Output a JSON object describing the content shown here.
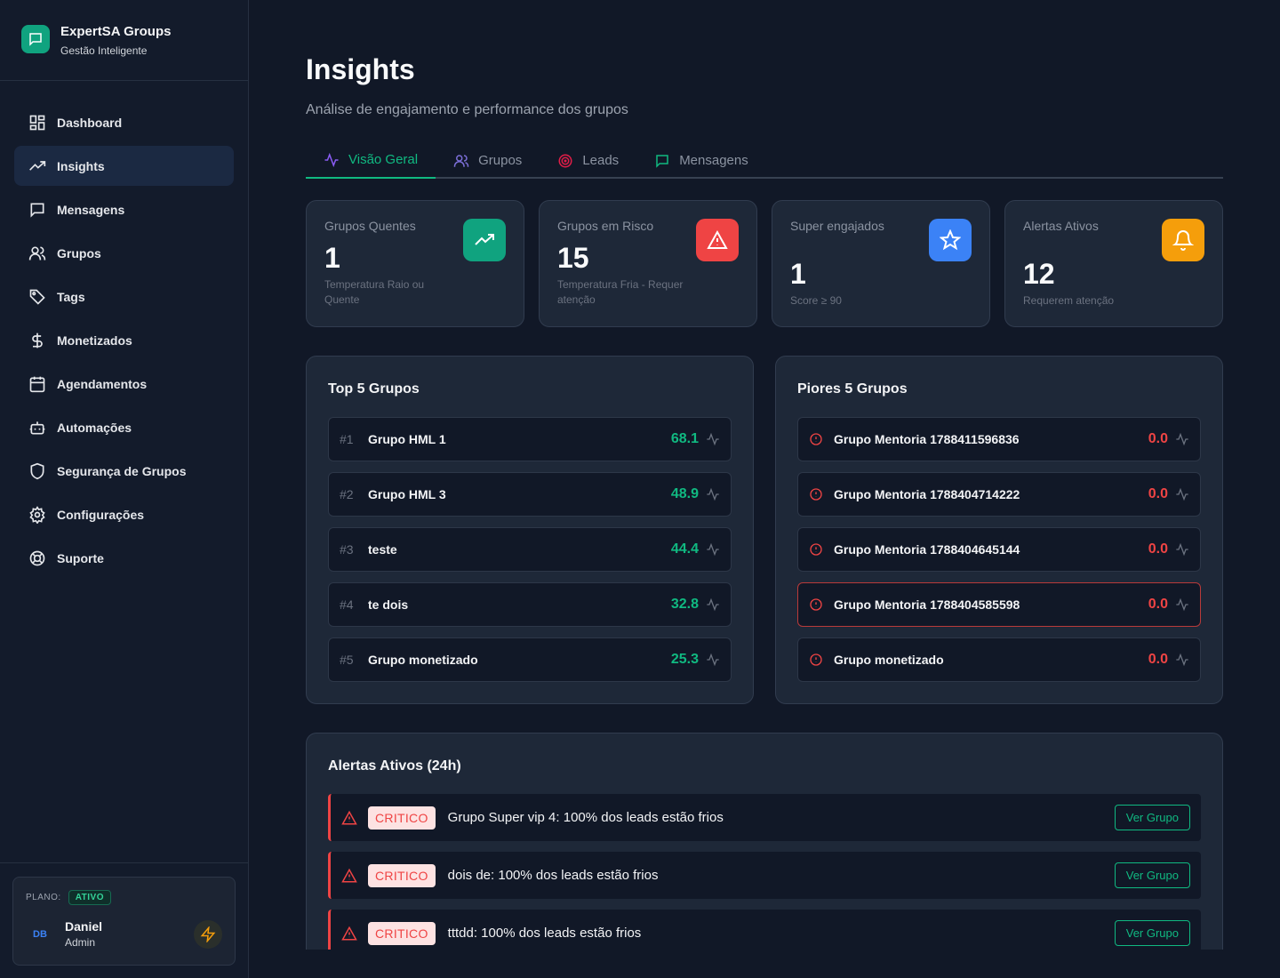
{
  "brand": {
    "title": "ExpertSA Groups",
    "subtitle": "Gestão Inteligente"
  },
  "nav": [
    {
      "label": "Dashboard",
      "icon": "grid-icon"
    },
    {
      "label": "Insights",
      "icon": "trending-up-icon",
      "active": true
    },
    {
      "label": "Mensagens",
      "icon": "message-icon"
    },
    {
      "label": "Grupos",
      "icon": "users-icon"
    },
    {
      "label": "Tags",
      "icon": "tag-icon"
    },
    {
      "label": "Monetizados",
      "icon": "dollar-icon"
    },
    {
      "label": "Agendamentos",
      "icon": "calendar-icon"
    },
    {
      "label": "Automações",
      "icon": "robot-icon"
    },
    {
      "label": "Segurança de Grupos",
      "icon": "shield-icon"
    },
    {
      "label": "Configurações",
      "icon": "gear-icon"
    },
    {
      "label": "Suporte",
      "icon": "lifebuoy-icon"
    }
  ],
  "plan": {
    "label": "PLANO:",
    "status": "ATIVO"
  },
  "user": {
    "initials": "DB",
    "name": "Daniel",
    "role": "Admin"
  },
  "page": {
    "title": "Insights",
    "subtitle": "Análise de engajamento e performance dos grupos"
  },
  "tabs": [
    {
      "label": "Visão Geral",
      "active": true
    },
    {
      "label": "Grupos"
    },
    {
      "label": "Leads"
    },
    {
      "label": "Mensagens"
    }
  ],
  "stats": [
    {
      "label": "Grupos Quentes",
      "value": "1",
      "note": "Temperatura Raio ou Quente",
      "color": "#10a37f",
      "icon": "trending-up-icon"
    },
    {
      "label": "Grupos em Risco",
      "value": "15",
      "note": "Temperatura Fria - Requer atenção",
      "color": "#ef4444",
      "icon": "warning-icon"
    },
    {
      "label": "Super engajados",
      "value": "1",
      "note": "Score ≥ 90",
      "color": "#3b82f6",
      "icon": "star-icon"
    },
    {
      "label": "Alertas Ativos",
      "value": "12",
      "note": "Requerem atenção",
      "color": "#f59e0b",
      "icon": "bell-icon"
    }
  ],
  "top": {
    "title": "Top 5 Grupos",
    "rows": [
      {
        "rank": "#1",
        "name": "Grupo HML 1",
        "score": "68.1"
      },
      {
        "rank": "#2",
        "name": "Grupo HML 3",
        "score": "48.9"
      },
      {
        "rank": "#3",
        "name": "teste",
        "score": "44.4"
      },
      {
        "rank": "#4",
        "name": "te dois",
        "score": "32.8"
      },
      {
        "rank": "#5",
        "name": "Grupo monetizado",
        "score": "25.3"
      }
    ]
  },
  "worst": {
    "title": "Piores 5 Grupos",
    "rows": [
      {
        "name": "Grupo Mentoria 1788411596836",
        "score": "0.0"
      },
      {
        "name": "Grupo Mentoria 1788404714222",
        "score": "0.0"
      },
      {
        "name": "Grupo Mentoria 1788404645144",
        "score": "0.0"
      },
      {
        "name": "Grupo Mentoria 1788404585598",
        "score": "0.0",
        "highlight": true
      },
      {
        "name": "Grupo monetizado",
        "score": "0.0"
      }
    ]
  },
  "alerts": {
    "title": "Alertas Ativos (24h)",
    "button_label": "Ver Grupo",
    "items": [
      {
        "tag": "CRITICO",
        "text": "Grupo Super vip 4: 100% dos leads estão frios"
      },
      {
        "tag": "CRITICO",
        "text": "dois de: 100% dos leads estão frios"
      },
      {
        "tag": "CRITICO",
        "text": "tttdd: 100% dos leads estão frios"
      }
    ]
  }
}
